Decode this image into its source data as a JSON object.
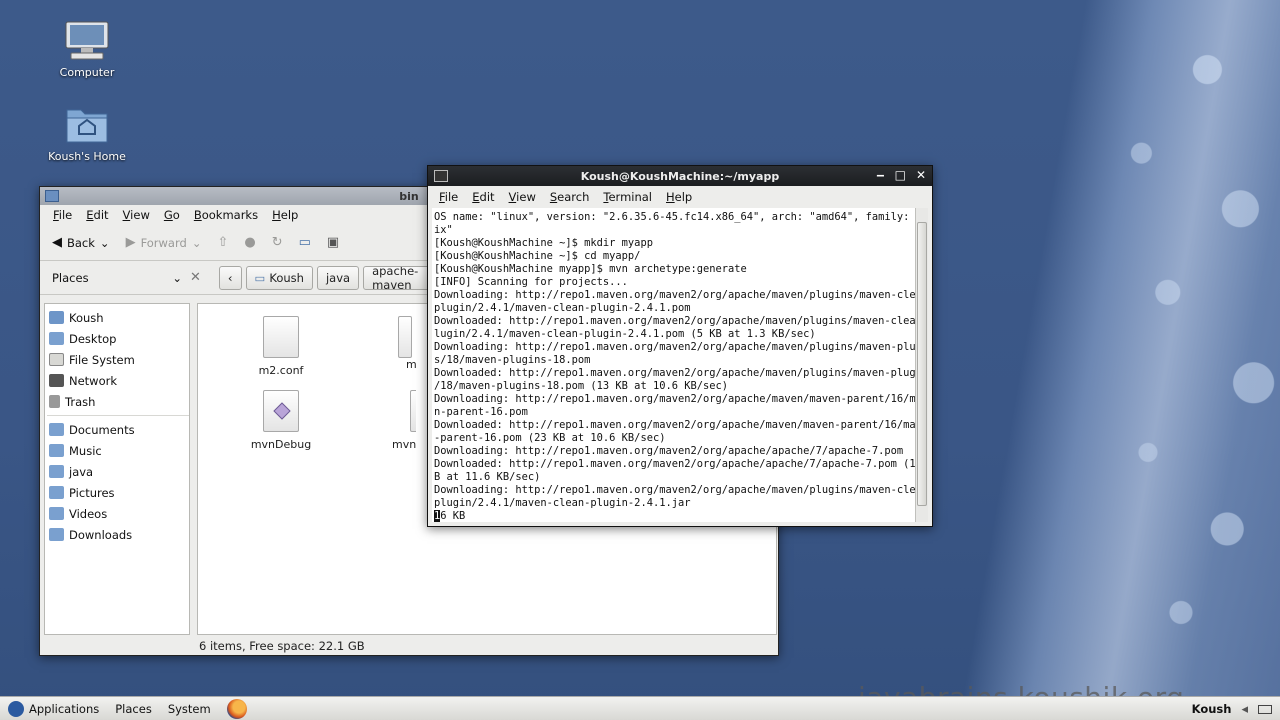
{
  "desktop": {
    "icons": [
      {
        "label": "Computer"
      },
      {
        "label": "Koush's Home"
      }
    ]
  },
  "file_manager": {
    "title": "bin",
    "menu": [
      "File",
      "Edit",
      "View",
      "Go",
      "Bookmarks",
      "Help"
    ],
    "toolbar": {
      "back": "Back",
      "forward": "Forward"
    },
    "places_label": "Places",
    "breadcrumbs": [
      "Koush",
      "java",
      "apache-maven"
    ],
    "sidebar": {
      "group1": [
        "Koush",
        "Desktop",
        "File System",
        "Network",
        "Trash"
      ],
      "group2": [
        "Documents",
        "Music",
        "java",
        "Pictures",
        "Videos",
        "Downloads"
      ]
    },
    "files": [
      "m2.conf",
      "m",
      "mvnDebug",
      "mvnD"
    ],
    "status": "6 items, Free space: 22.1 GB"
  },
  "terminal": {
    "title": "Koush@KoushMachine:~/myapp",
    "menu": [
      "File",
      "Edit",
      "View",
      "Search",
      "Terminal",
      "Help"
    ],
    "lines": [
      "OS name: \"linux\", version: \"2.6.35.6-45.fc14.x86_64\", arch: \"amd64\", family: \"un",
      "ix\"",
      "[Koush@KoushMachine ~]$ mkdir myapp",
      "[Koush@KoushMachine ~]$ cd myapp/",
      "[Koush@KoushMachine myapp]$ mvn archetype:generate",
      "[INFO] Scanning for projects...",
      "Downloading: http://repo1.maven.org/maven2/org/apache/maven/plugins/maven-clean-",
      "plugin/2.4.1/maven-clean-plugin-2.4.1.pom",
      "Downloaded: http://repo1.maven.org/maven2/org/apache/maven/plugins/maven-clean-p",
      "lugin/2.4.1/maven-clean-plugin-2.4.1.pom (5 KB at 1.3 KB/sec)",
      "Downloading: http://repo1.maven.org/maven2/org/apache/maven/plugins/maven-plugin",
      "s/18/maven-plugins-18.pom",
      "Downloaded: http://repo1.maven.org/maven2/org/apache/maven/plugins/maven-plugins",
      "/18/maven-plugins-18.pom (13 KB at 10.6 KB/sec)",
      "Downloading: http://repo1.maven.org/maven2/org/apache/maven/maven-parent/16/mave",
      "n-parent-16.pom",
      "Downloaded: http://repo1.maven.org/maven2/org/apache/maven/maven-parent/16/maven",
      "-parent-16.pom (23 KB at 10.6 KB/sec)",
      "Downloading: http://repo1.maven.org/maven2/org/apache/apache/7/apache-7.pom",
      "Downloaded: http://repo1.maven.org/maven2/org/apache/apache/7/apache-7.pom (15 K",
      "B at 11.6 KB/sec)",
      "Downloading: http://repo1.maven.org/maven2/org/apache/maven/plugins/maven-clean-",
      "plugin/2.4.1/maven-clean-plugin-2.4.1.jar"
    ],
    "cursor_char": "1",
    "last_line_rest": "6 KB"
  },
  "taskbar": {
    "items": [
      "Applications",
      "Places",
      "System"
    ],
    "watermark": "javabrains.koushik.org",
    "user": "Koush"
  }
}
